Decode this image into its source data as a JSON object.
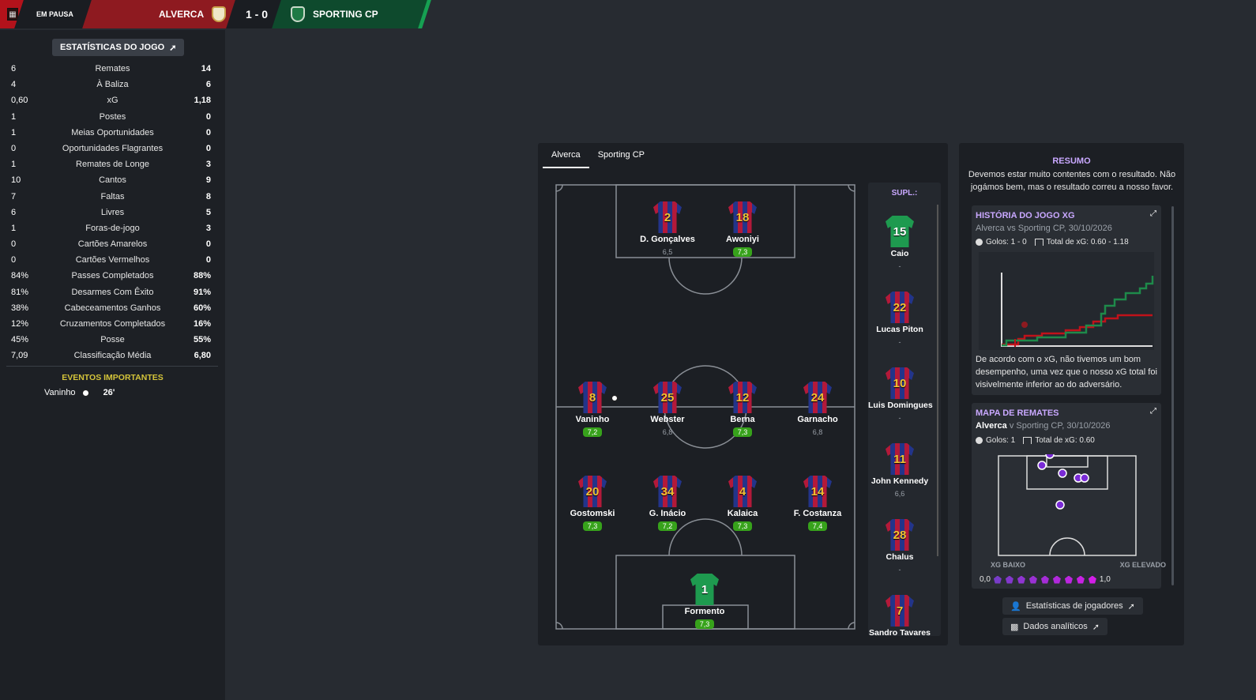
{
  "header": {
    "status": "EM PAUSA",
    "home_team": "ALVERCA",
    "score": "1 - 0",
    "away_team": "SPORTING CP",
    "colors": {
      "home": "#8e1a20",
      "away": "#0e4a2d",
      "accent": "#16a052"
    }
  },
  "stats": {
    "title": "ESTATÍSTICAS DO JOGO",
    "rows": [
      {
        "l": "6",
        "label": "Remates",
        "r": "14"
      },
      {
        "l": "4",
        "label": "À Baliza",
        "r": "6"
      },
      {
        "l": "0,60",
        "label": "xG",
        "r": "1,18"
      },
      {
        "l": "1",
        "label": "Postes",
        "r": "0"
      },
      {
        "l": "1",
        "label": "Meias Oportunidades",
        "r": "0"
      },
      {
        "l": "0",
        "label": "Oportunidades Flagrantes",
        "r": "0"
      },
      {
        "l": "1",
        "label": "Remates de Longe",
        "r": "3"
      },
      {
        "l": "10",
        "label": "Cantos",
        "r": "9"
      },
      {
        "l": "7",
        "label": "Faltas",
        "r": "8"
      },
      {
        "l": "6",
        "label": "Livres",
        "r": "5"
      },
      {
        "l": "1",
        "label": "Foras-de-jogo",
        "r": "3"
      },
      {
        "l": "0",
        "label": "Cartões Amarelos",
        "r": "0"
      },
      {
        "l": "0",
        "label": "Cartões Vermelhos",
        "r": "0"
      },
      {
        "l": "84%",
        "label": "Passes Completados",
        "r": "88%"
      },
      {
        "l": "81%",
        "label": "Desarmes Com Êxito",
        "r": "91%"
      },
      {
        "l": "38%",
        "label": "Cabeceamentos Ganhos",
        "r": "60%"
      },
      {
        "l": "12%",
        "label": "Cruzamentos Completados",
        "r": "16%"
      },
      {
        "l": "45%",
        "label": "Posse",
        "r": "55%"
      },
      {
        "l": "7,09",
        "label": "Classificação Média",
        "r": "6,80"
      }
    ]
  },
  "events": {
    "title": "EVENTOS IMPORTANTES",
    "items": [
      {
        "player": "Vaninho",
        "minute": "26'"
      }
    ]
  },
  "lineup": {
    "tabs": [
      "Alverca",
      "Sporting CP"
    ],
    "players": [
      {
        "num": "2",
        "name": "D. Gonçalves",
        "rating": "6,5",
        "good": false,
        "gk": false
      },
      {
        "num": "18",
        "name": "Awoniyi",
        "rating": "7,3",
        "good": true,
        "gk": false
      },
      {
        "num": "8",
        "name": "Vaninho",
        "rating": "7,2",
        "good": true,
        "gk": false
      },
      {
        "num": "25",
        "name": "Webster",
        "rating": "6,8",
        "good": false,
        "gk": false
      },
      {
        "num": "12",
        "name": "Berna",
        "rating": "7,3",
        "good": true,
        "gk": false
      },
      {
        "num": "24",
        "name": "Garnacho",
        "rating": "6,8",
        "good": false,
        "gk": false
      },
      {
        "num": "20",
        "name": "Gostomski",
        "rating": "7,3",
        "good": true,
        "gk": false
      },
      {
        "num": "34",
        "name": "G. Inácio",
        "rating": "7,2",
        "good": true,
        "gk": false
      },
      {
        "num": "4",
        "name": "Kalaica",
        "rating": "7,3",
        "good": true,
        "gk": false
      },
      {
        "num": "14",
        "name": "F. Costanza",
        "rating": "7,4",
        "good": true,
        "gk": false
      },
      {
        "num": "1",
        "name": "Formento",
        "rating": "7,3",
        "good": true,
        "gk": true
      }
    ],
    "subs_title": "SUPL.:",
    "subs": [
      {
        "num": "15",
        "name": "Caio",
        "rating": "-",
        "gk": true
      },
      {
        "num": "22",
        "name": "Lucas Piton",
        "rating": "-",
        "gk": false
      },
      {
        "num": "10",
        "name": "Luis Domingues",
        "rating": "-",
        "gk": false
      },
      {
        "num": "11",
        "name": "John Kennedy",
        "rating": "6,6",
        "gk": false
      },
      {
        "num": "28",
        "name": "Chalus",
        "rating": "-",
        "gk": false
      },
      {
        "num": "7",
        "name": "Sandro Tavares",
        "rating": "",
        "gk": false
      }
    ]
  },
  "summary": {
    "title": "RESUMO",
    "text": "Devemos estar muito contentes com o resultado. Não jogámos bem, mas o resultado correu a nosso favor.",
    "xg_history": {
      "title": "HISTÓRIA DO JOGO XG",
      "subtitle": "Alverca vs Sporting CP, 30/10/2026",
      "goals": "Golos: 1 - 0",
      "total_xg": "Total de xG: 0.60 - 1.18",
      "text": "De acordo com o xG, não tivemos um bom desempenho, uma vez que o nosso xG total foi visivelmente inferior ao do adversário."
    },
    "shot_map": {
      "title": "MAPA DE REMATES",
      "team": "Alverca",
      "subtitle_rest": " v Sporting CP, 30/10/2026",
      "goals": "Golos: 1",
      "total_xg": "Total de xG: 0.60",
      "low": "XG BAIXO",
      "high": "XG ELEVADO",
      "min": "0,0",
      "max": "1,0"
    },
    "links": [
      "Estatísticas de jogadores",
      "Dados analíticos"
    ]
  }
}
